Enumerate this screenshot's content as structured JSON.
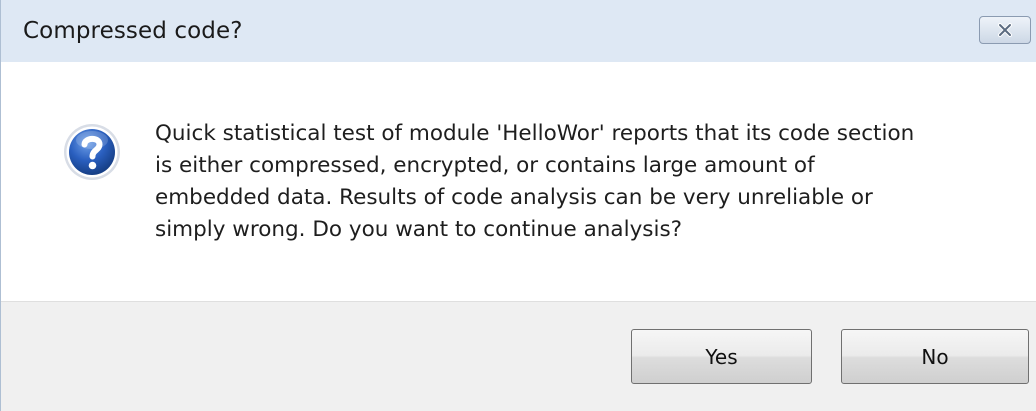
{
  "dialog": {
    "title": "Compressed code?",
    "close_icon": "close-icon",
    "icon": "question-icon",
    "message": "Quick statistical test of module 'HelloWor' reports that its code section\nis either compressed, encrypted, or contains large amount of\nembedded data. Results of code analysis can be very unreliable or\nsimply wrong. Do you want to continue analysis?",
    "buttons": {
      "yes_label": "Yes",
      "no_label": "No"
    }
  },
  "colors": {
    "titlebar": "#dee8f4",
    "footer": "#f0f0f0",
    "icon_blue": "#1f4fa6"
  }
}
